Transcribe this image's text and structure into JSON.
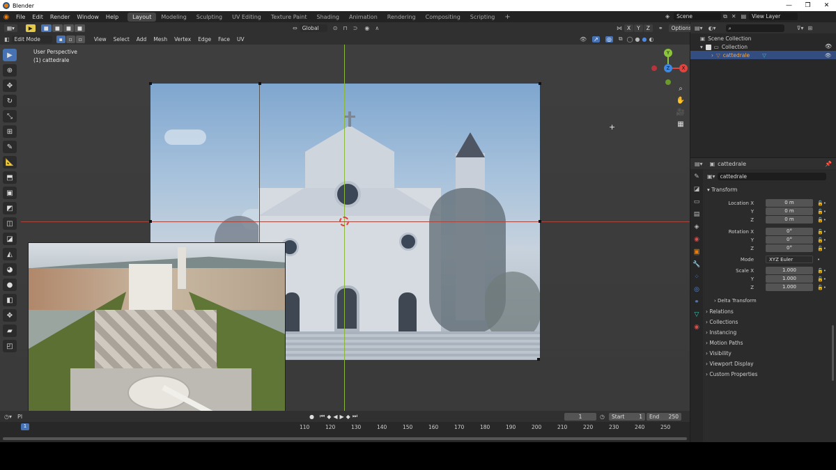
{
  "app_title": "Blender",
  "window_controls": {
    "minimize": "—",
    "restore": "❐",
    "close": "✕"
  },
  "menu": [
    "File",
    "Edit",
    "Render",
    "Window",
    "Help"
  ],
  "workspaces": [
    "Layout",
    "Modeling",
    "Sculpting",
    "UV Editing",
    "Texture Paint",
    "Shading",
    "Animation",
    "Rendering",
    "Compositing",
    "Scripting"
  ],
  "active_workspace": "Layout",
  "scene_label": "Scene",
  "view_layer_label": "View Layer",
  "viewport_header": {
    "transform_orientation": "Global",
    "axes": [
      "X",
      "Y",
      "Z"
    ],
    "options_label": "Options"
  },
  "edit_header": {
    "mode": "Edit Mode",
    "menus": [
      "View",
      "Select",
      "Add",
      "Mesh",
      "Vertex",
      "Edge",
      "Face",
      "UV"
    ]
  },
  "viewport": {
    "perspective_label": "User Perspective",
    "object_label": "(1) cattedrale",
    "gizmo_axes": [
      "Y",
      "X",
      "Z"
    ]
  },
  "outliner": {
    "scene_collection": "Scene Collection",
    "collection": "Collection",
    "object": "cattedrale"
  },
  "properties": {
    "header_object": "cattedrale",
    "name_field": "cattedrale",
    "section": "Transform",
    "location": {
      "label": "Location X",
      "x": "0 m",
      "y": "0 m",
      "z": "0 m"
    },
    "rotation": {
      "label": "Rotation X",
      "x": "0°",
      "y": "0°",
      "z": "0°"
    },
    "mode_label": "Mode",
    "mode_value": "XYZ Euler",
    "scale": {
      "label": "Scale X",
      "x": "1.000",
      "y": "1.000",
      "z": "1.000"
    },
    "axis_y": "Y",
    "axis_z": "Z",
    "delta_transform": "Delta Transform",
    "panels": [
      "Relations",
      "Collections",
      "Instancing",
      "Motion Paths",
      "Visibility",
      "Viewport Display",
      "Custom Properties"
    ]
  },
  "timeline": {
    "playback_label": "Pl",
    "current_frame": "1",
    "start_label": "Start",
    "start_value": "1",
    "end_label": "End",
    "end_value": "250",
    "ruler": [
      "110",
      "120",
      "130",
      "140",
      "150",
      "160",
      "170",
      "180",
      "190",
      "200",
      "210",
      "220",
      "230",
      "240",
      "250"
    ]
  },
  "colors": {
    "accent": "#4772b3",
    "axis_x": "#e0443e",
    "axis_y": "#8dc43e",
    "axis_z": "#3e88e0",
    "object_orange": "#e87d0d"
  }
}
